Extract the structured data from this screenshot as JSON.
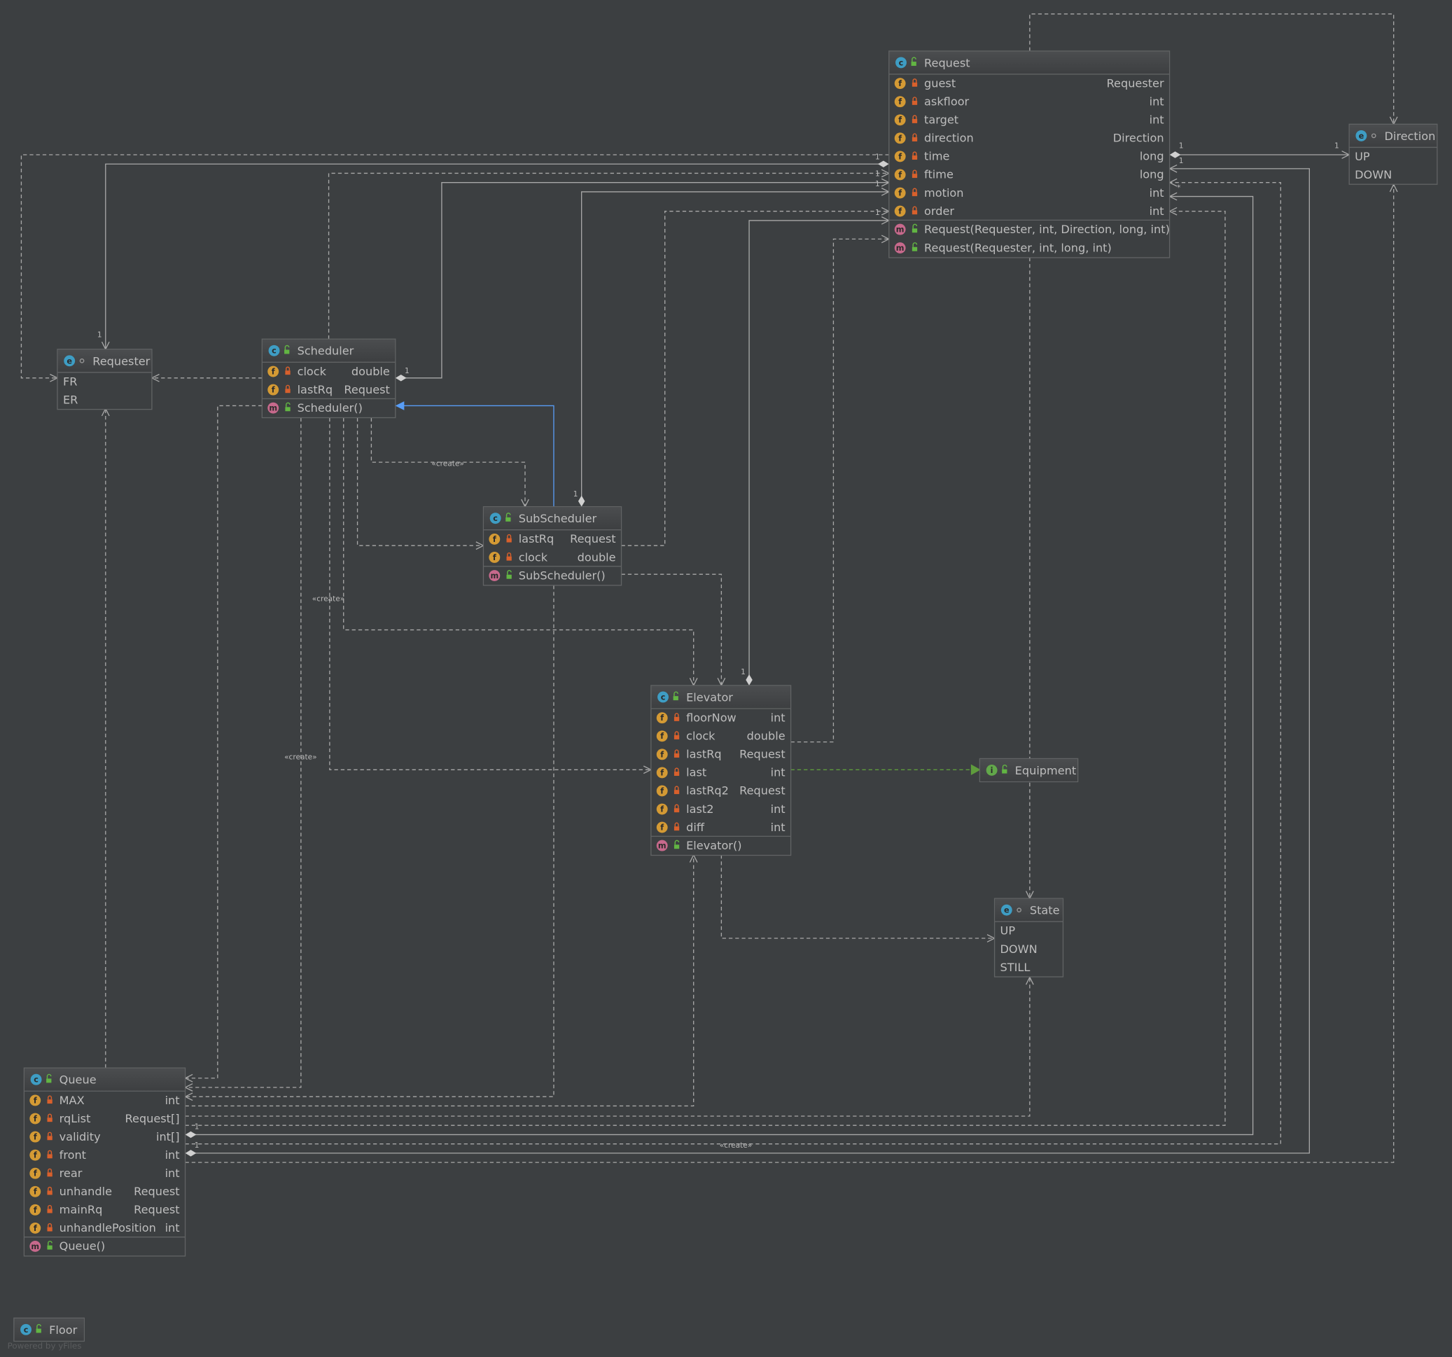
{
  "colors": {
    "background": "#3c3f41",
    "class_icon": "#3e9dc4",
    "enum_icon": "#3e9dc4",
    "interface_icon": "#62a84a",
    "field_icon": "#d49a34",
    "method_icon": "#c7698c",
    "private_lock": "#d8602c",
    "public_lock": "#62b543",
    "inheritance_edge": "#589df6",
    "realization_edge": "#5f9c3d"
  },
  "boxes": [
    {
      "id": "request",
      "name": "Request",
      "kind": "class",
      "icon": "C",
      "visibility": "public",
      "fields": [
        {
          "name": "guest",
          "type": "Requester",
          "access": "private"
        },
        {
          "name": "askfloor",
          "type": "int",
          "access": "private"
        },
        {
          "name": "target",
          "type": "int",
          "access": "private"
        },
        {
          "name": "direction",
          "type": "Direction",
          "access": "private"
        },
        {
          "name": "time",
          "type": "long",
          "access": "private"
        },
        {
          "name": "ftime",
          "type": "long",
          "access": "private"
        },
        {
          "name": "motion",
          "type": "int",
          "access": "private"
        },
        {
          "name": "order",
          "type": "int",
          "access": "private"
        }
      ],
      "methods": [
        {
          "name": "Request(Requester, int, Direction, long, int)",
          "access": "public"
        },
        {
          "name": "Request(Requester, int, long, int)",
          "access": "public"
        }
      ]
    },
    {
      "id": "direction",
      "name": "Direction",
      "kind": "enum",
      "icon": "E",
      "visibility": "package",
      "constants": [
        "UP",
        "DOWN"
      ]
    },
    {
      "id": "requester",
      "name": "Requester",
      "kind": "enum",
      "icon": "E",
      "visibility": "package",
      "constants": [
        "FR",
        "ER"
      ]
    },
    {
      "id": "scheduler",
      "name": "Scheduler",
      "kind": "class",
      "icon": "C",
      "visibility": "public",
      "fields": [
        {
          "name": "clock",
          "type": "double",
          "access": "private"
        },
        {
          "name": "lastRq",
          "type": "Request",
          "access": "private"
        }
      ],
      "methods": [
        {
          "name": "Scheduler()",
          "access": "public"
        }
      ]
    },
    {
      "id": "subscheduler",
      "name": "SubScheduler",
      "kind": "class",
      "icon": "C",
      "visibility": "public",
      "fields": [
        {
          "name": "lastRq",
          "type": "Request",
          "access": "private"
        },
        {
          "name": "clock",
          "type": "double",
          "access": "private"
        }
      ],
      "methods": [
        {
          "name": "SubScheduler()",
          "access": "public"
        }
      ]
    },
    {
      "id": "elevator",
      "name": "Elevator",
      "kind": "class",
      "icon": "C",
      "visibility": "public",
      "fields": [
        {
          "name": "floorNow",
          "type": "int",
          "access": "private"
        },
        {
          "name": "clock",
          "type": "double",
          "access": "private"
        },
        {
          "name": "lastRq",
          "type": "Request",
          "access": "private"
        },
        {
          "name": "last",
          "type": "int",
          "access": "private"
        },
        {
          "name": "lastRq2",
          "type": "Request",
          "access": "private"
        },
        {
          "name": "last2",
          "type": "int",
          "access": "private"
        },
        {
          "name": "diff",
          "type": "int",
          "access": "private"
        }
      ],
      "methods": [
        {
          "name": "Elevator()",
          "access": "public"
        }
      ]
    },
    {
      "id": "equipment",
      "name": "Equipment",
      "kind": "interface",
      "icon": "I",
      "visibility": "public"
    },
    {
      "id": "state",
      "name": "State",
      "kind": "enum",
      "icon": "E",
      "visibility": "package",
      "constants": [
        "UP",
        "DOWN",
        "STILL"
      ]
    },
    {
      "id": "queue",
      "name": "Queue",
      "kind": "class",
      "icon": "C",
      "visibility": "public",
      "fields": [
        {
          "name": "MAX",
          "type": "int",
          "access": "private"
        },
        {
          "name": "rqList",
          "type": "Request[]",
          "access": "private"
        },
        {
          "name": "validity",
          "type": "int[]",
          "access": "private"
        },
        {
          "name": "front",
          "type": "int",
          "access": "private"
        },
        {
          "name": "rear",
          "type": "int",
          "access": "private"
        },
        {
          "name": "unhandle",
          "type": "Request",
          "access": "private"
        },
        {
          "name": "mainRq",
          "type": "Request",
          "access": "private"
        },
        {
          "name": "unhandlePosition",
          "type": "int",
          "access": "private"
        }
      ],
      "methods": [
        {
          "name": "Queue()",
          "access": "public"
        }
      ]
    },
    {
      "id": "floor",
      "name": "Floor",
      "kind": "class",
      "icon": "C",
      "visibility": "public"
    }
  ],
  "labels": {
    "create": "«create»",
    "one": "1",
    "many": "*"
  },
  "watermark": "Powered by yFiles"
}
